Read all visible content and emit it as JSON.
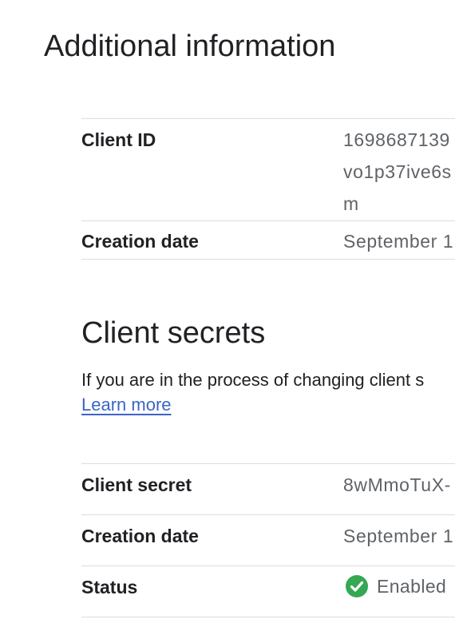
{
  "additional_info": {
    "title": "Additional information",
    "client_id_label": "Client ID",
    "client_id_value": "1698687139 vo1p37ive6s m",
    "creation_date_label": "Creation date",
    "creation_date_value": "September 1"
  },
  "client_secrets": {
    "title": "Client secrets",
    "description": "If you are in the process of changing client s",
    "learn_more": "Learn more",
    "client_secret_label": "Client secret",
    "client_secret_value": "8wMmoTuX-",
    "creation_date_label": "Creation date",
    "creation_date_value": "September 1",
    "status_label": "Status",
    "status_value": "Enabled",
    "status_icon": "check-circle-icon",
    "status_color": "#34a853"
  }
}
